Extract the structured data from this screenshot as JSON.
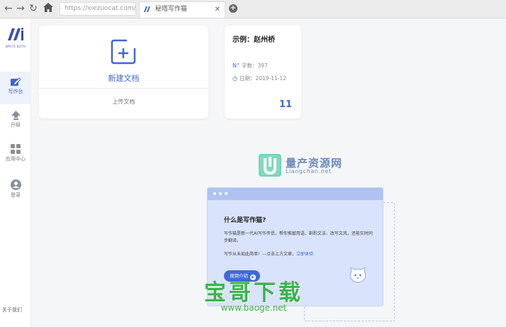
{
  "browser": {
    "url": "https://xiezuocat.com/#/",
    "tab_title": "秘塔写作猫",
    "tab_close": "✕",
    "new_tab": "+"
  },
  "sidebar": {
    "logo_text": "WRITE BOTH",
    "items": [
      {
        "label": "写作台",
        "icon": "edit-icon",
        "active": true
      },
      {
        "label": "升级",
        "icon": "upload-arrow-icon",
        "active": false
      },
      {
        "label": "应用中心",
        "icon": "apps-grid-icon",
        "active": false
      },
      {
        "label": "登录",
        "icon": "user-icon",
        "active": false
      }
    ],
    "about": "关于我们"
  },
  "new_doc_card": {
    "new_label": "新建文档",
    "upload_label": "上传文档"
  },
  "example_card": {
    "title": "示例：赵州桥",
    "word_count": "字数：397",
    "date": "日期：2019-11-12",
    "count": "11",
    "icon_words": "N°",
    "icon_date": "◷"
  },
  "watermark_top": {
    "title": "量产资源网",
    "subtitle": "Liangchan.net"
  },
  "intro_panel": {
    "question": "什么是写作猫?",
    "paragraph1": "写作猫是新一代AI写作伴侣，帮你推敲用语、斟酌文法、改写文风，还能实时同步翻译。",
    "paragraph2_prefix": "写作从未如此简单！—点击上方文章，",
    "paragraph2_link": "立即体验",
    "video_button": "视频介绍",
    "play_glyph": "▶"
  },
  "watermark_bottom": {
    "title": "宝哥下载",
    "url": "www.baoge.net"
  },
  "colors": {
    "accent": "#3f67d8",
    "panel_bg": "#d9e3fb",
    "watermark_green": "#39b54a"
  }
}
